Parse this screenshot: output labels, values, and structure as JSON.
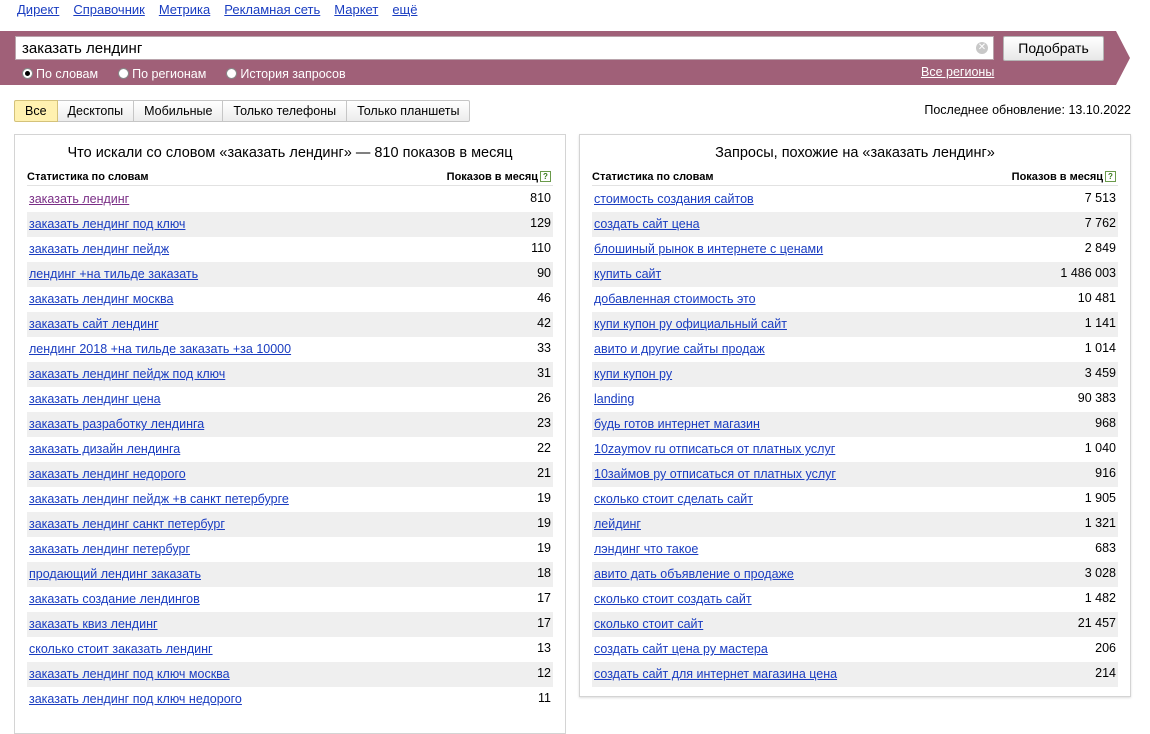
{
  "topnav": [
    "Директ",
    "Справочник",
    "Метрика",
    "Рекламная сеть",
    "Маркет",
    "ещё"
  ],
  "search": {
    "value": "заказать лендинг",
    "button": "Подобрать",
    "clear_icon": "close-circle-icon",
    "radios": [
      {
        "label": "По словам",
        "checked": true
      },
      {
        "label": "По регионам",
        "checked": false
      },
      {
        "label": "История запросов",
        "checked": false
      }
    ],
    "regions_link": "Все регионы",
    "band_color": "#a06078"
  },
  "tabs": [
    {
      "label": "Все",
      "active": true
    },
    {
      "label": "Десктопы",
      "active": false
    },
    {
      "label": "Мобильные",
      "active": false
    },
    {
      "label": "Только телефоны",
      "active": false
    },
    {
      "label": "Только планшеты",
      "active": false
    }
  ],
  "last_update": "Последнее обновление: 13.10.2022",
  "left": {
    "title": "Что искали со словом «заказать лендинг» — 810 показов в месяц",
    "col1": "Статистика по словам",
    "col2": "Показов в месяц",
    "rows": [
      {
        "q": "заказать лендинг",
        "n": "810",
        "visited": true
      },
      {
        "q": "заказать лендинг под ключ",
        "n": "129"
      },
      {
        "q": "заказать лендинг пейдж",
        "n": "110"
      },
      {
        "q": "лендинг +на тильде заказать",
        "n": "90"
      },
      {
        "q": "заказать лендинг москва",
        "n": "46"
      },
      {
        "q": "заказать сайт лендинг",
        "n": "42"
      },
      {
        "q": "лендинг 2018 +на тильде заказать +за 10000",
        "n": "33"
      },
      {
        "q": "заказать лендинг пейдж под ключ",
        "n": "31"
      },
      {
        "q": "заказать лендинг цена",
        "n": "26"
      },
      {
        "q": "заказать разработку лендинга",
        "n": "23"
      },
      {
        "q": "заказать дизайн лендинга",
        "n": "22"
      },
      {
        "q": "заказать лендинг недорого",
        "n": "21"
      },
      {
        "q": "заказать лендинг пейдж +в санкт петербурге",
        "n": "19"
      },
      {
        "q": "заказать лендинг санкт петербург",
        "n": "19"
      },
      {
        "q": "заказать лендинг петербург",
        "n": "19"
      },
      {
        "q": "продающий лендинг заказать",
        "n": "18"
      },
      {
        "q": "заказать создание лендингов",
        "n": "17"
      },
      {
        "q": "заказать квиз лендинг",
        "n": "17"
      },
      {
        "q": "сколько стоит заказать лендинг",
        "n": "13"
      },
      {
        "q": "заказать лендинг под ключ москва",
        "n": "12"
      },
      {
        "q": "заказать лендинг под ключ недорого",
        "n": "11"
      }
    ]
  },
  "right": {
    "title": "Запросы, похожие на «заказать лендинг»",
    "col1": "Статистика по словам",
    "col2": "Показов в месяц",
    "rows": [
      {
        "q": "стоимость создания сайтов",
        "n": "7 513"
      },
      {
        "q": "создать сайт цена",
        "n": "7 762"
      },
      {
        "q": "блошиный рынок в интернете с ценами",
        "n": "2 849"
      },
      {
        "q": "купить сайт",
        "n": "1 486 003"
      },
      {
        "q": "добавленная стоимость это",
        "n": "10 481"
      },
      {
        "q": "купи купон ру официальный сайт",
        "n": "1 141"
      },
      {
        "q": "авито и другие сайты продаж",
        "n": "1 014"
      },
      {
        "q": "купи купон ру",
        "n": "3 459"
      },
      {
        "q": "landing",
        "n": "90 383"
      },
      {
        "q": "будь готов интернет магазин",
        "n": "968"
      },
      {
        "q": "10zaymov ru отписаться от платных услуг",
        "n": "1 040"
      },
      {
        "q": "10займов ру отписаться от платных услуг",
        "n": "916"
      },
      {
        "q": "сколько стоит сделать сайт",
        "n": "1 905"
      },
      {
        "q": "лейдинг",
        "n": "1 321"
      },
      {
        "q": "лэндинг что такое",
        "n": "683"
      },
      {
        "q": "авито дать объявление о продаже",
        "n": "3 028"
      },
      {
        "q": "сколько стоит создать сайт",
        "n": "1 482"
      },
      {
        "q": "сколько стоит сайт",
        "n": "21 457"
      },
      {
        "q": "создать сайт цена ру мастера",
        "n": "206"
      },
      {
        "q": "создать сайт для интернет магазина цена",
        "n": "214"
      }
    ]
  }
}
